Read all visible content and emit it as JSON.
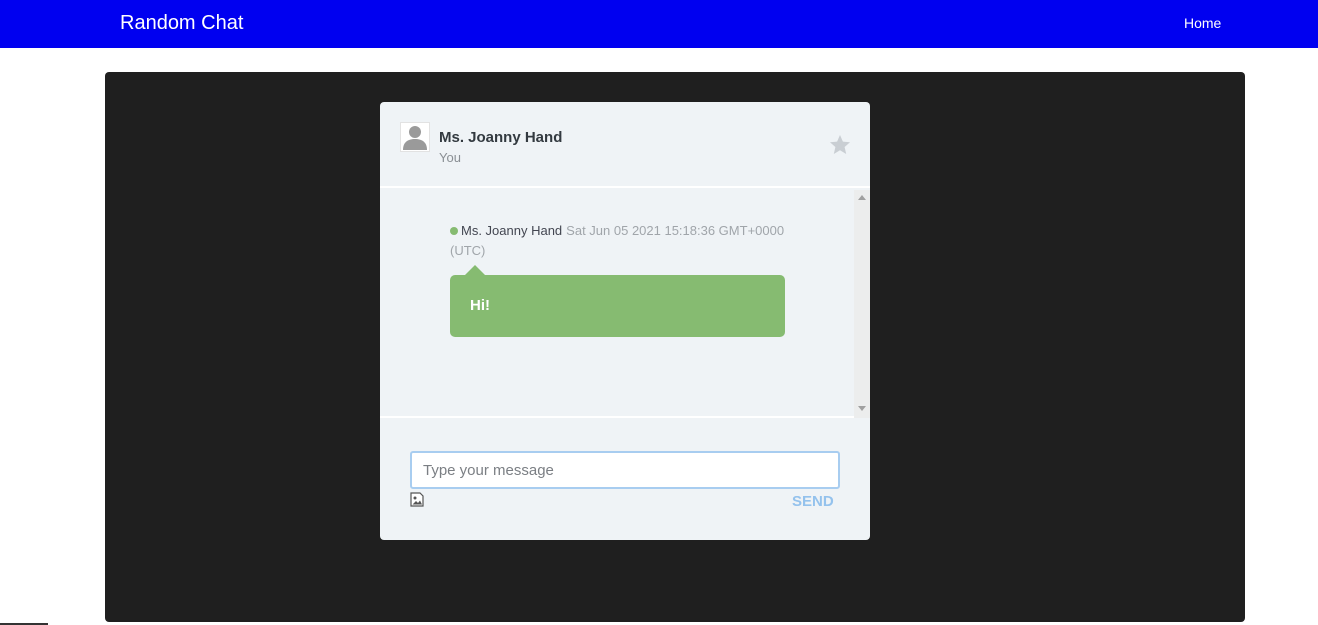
{
  "navbar": {
    "brand": "Random Chat",
    "home_link": "Home"
  },
  "chat": {
    "header": {
      "name": "Ms. Joanny Hand",
      "subtitle": "You"
    },
    "messages": [
      {
        "author": "Ms. Joanny Hand",
        "timestamp": "Sat Jun 05 2021 15:18:36 GMT+0000 (UTC)",
        "text": "Hi!",
        "status": "online"
      }
    ],
    "composer": {
      "placeholder": "Type your message",
      "value": "",
      "send_label": "SEND"
    }
  },
  "icons": {
    "avatar": "user-silhouette-icon",
    "favorite": "star-icon",
    "attach_image": "image-icon",
    "status": "online-dot"
  },
  "colors": {
    "navbar": "#0000f0",
    "stage": "#1f1f1f",
    "panel": "#eff3f6",
    "bubble": "#86bb71",
    "send": "#94c2ed",
    "input_border": "#a8cdf0"
  }
}
